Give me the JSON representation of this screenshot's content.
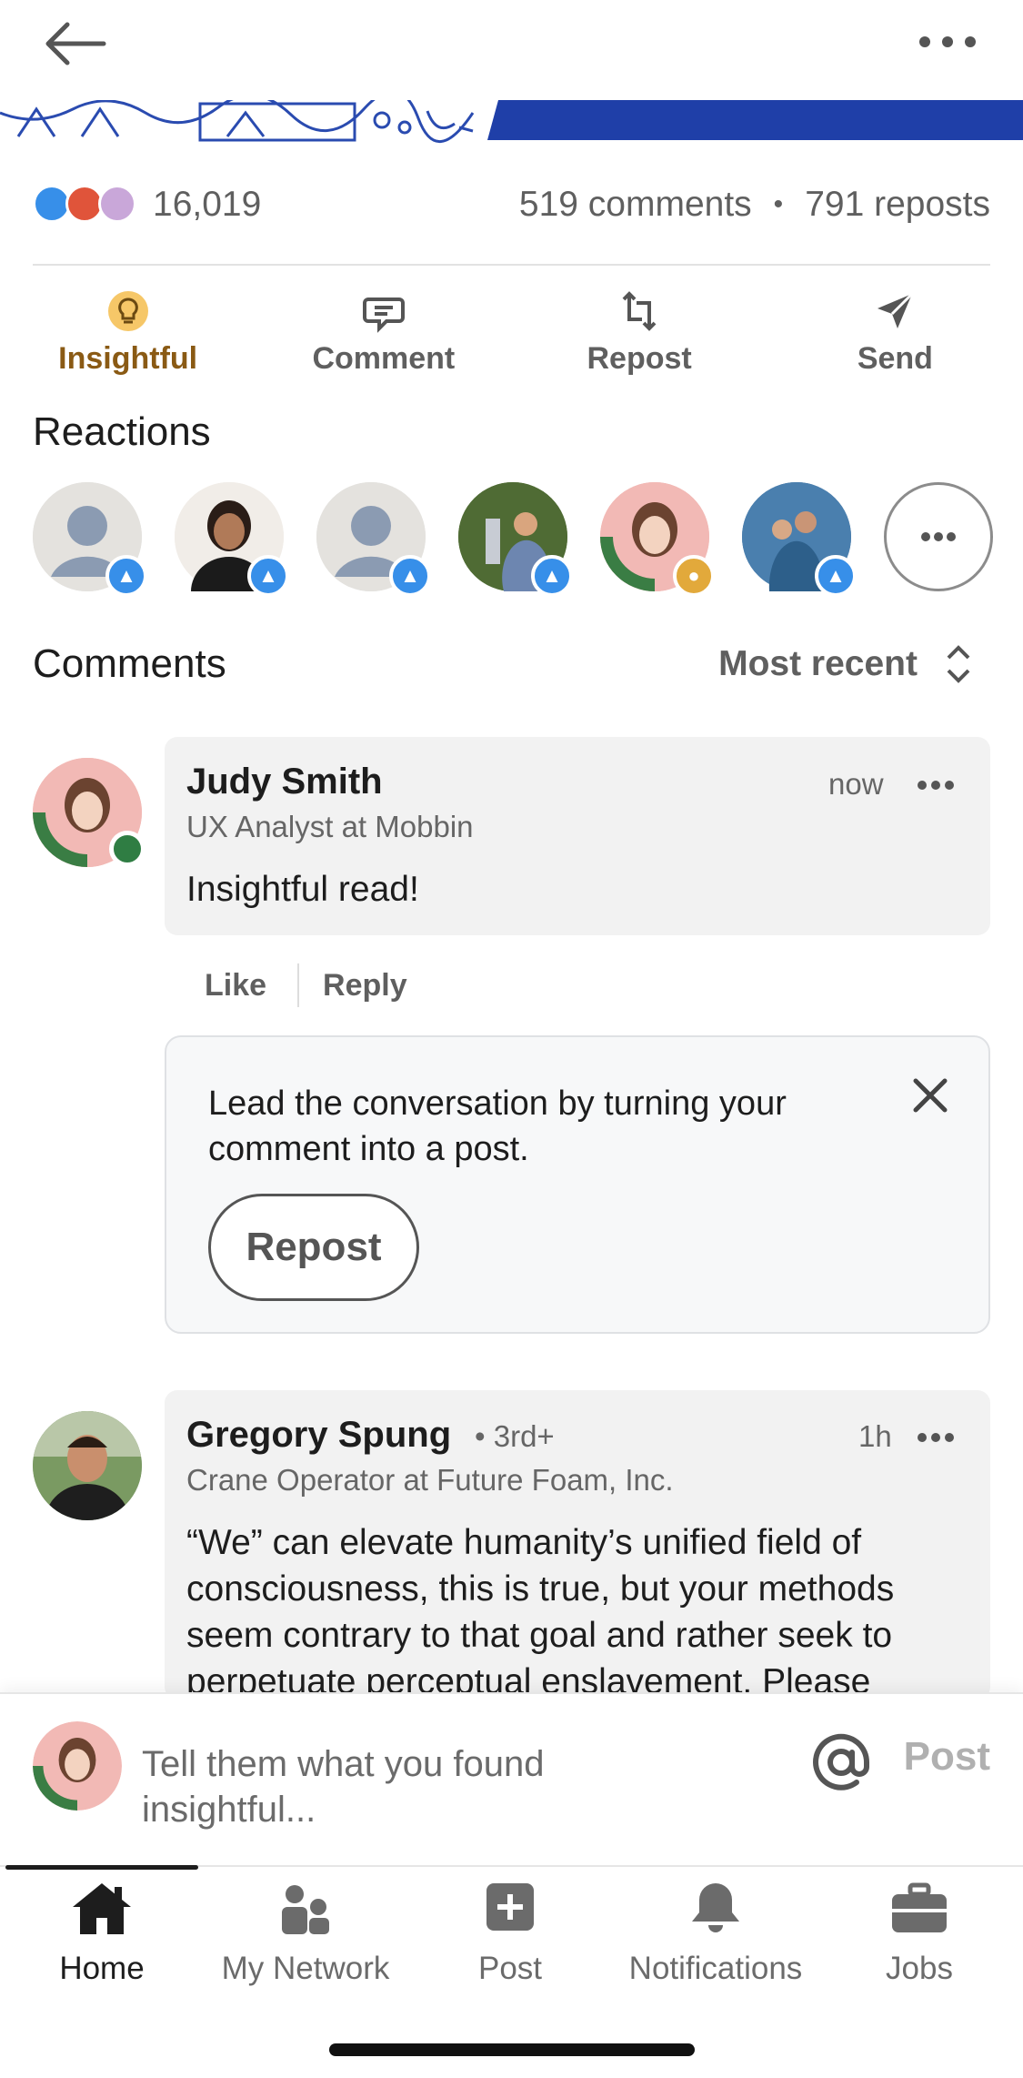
{
  "header": {
    "back_icon": "arrow-left-icon",
    "more_icon": "more-horizontal-icon"
  },
  "stats": {
    "reaction_icons": [
      "like-icon",
      "love-icon",
      "insightful-icon"
    ],
    "reactions_count": "16,019",
    "comments": "519 comments",
    "separator": "•",
    "reposts": "791 reposts"
  },
  "actions": {
    "insightful": "Insightful",
    "comment": "Comment",
    "repost": "Repost",
    "send": "Send"
  },
  "reactions": {
    "title": "Reactions"
  },
  "comments": {
    "title": "Comments",
    "sort_label": "Most recent",
    "items": [
      {
        "name": "Judy Smith",
        "degree": "",
        "headline": "UX Analyst at Mobbin",
        "time": "now",
        "body": "Insightful read!"
      },
      {
        "name": "Gregory Spung",
        "degree": "• 3rd+",
        "headline": "Crane Operator at Future Foam, Inc.",
        "time": "1h",
        "body": "“We” can elevate humanity’s unified field of consciousness, this is true, but your methods seem contrary to that goal and rather seek to perpetuate perceptual enslavement.  Please"
      }
    ],
    "like": "Like",
    "reply": "Reply"
  },
  "prompt": {
    "text": "Lead the conversation by turning your comment into a post.",
    "button": "Repost"
  },
  "composer": {
    "placeholder": "Tell them what you found insightful...",
    "post": "Post"
  },
  "tabs": [
    {
      "label": "Home",
      "icon": "home-icon"
    },
    {
      "label": "My Network",
      "icon": "network-icon"
    },
    {
      "label": "Post",
      "icon": "plus-square-icon"
    },
    {
      "label": "Notifications",
      "icon": "bell-icon"
    },
    {
      "label": "Jobs",
      "icon": "briefcase-icon"
    }
  ],
  "colors": {
    "accent_insightful": "#8a5a14",
    "like_blue": "#378fe9",
    "banner_blue": "#1f3fa8"
  }
}
